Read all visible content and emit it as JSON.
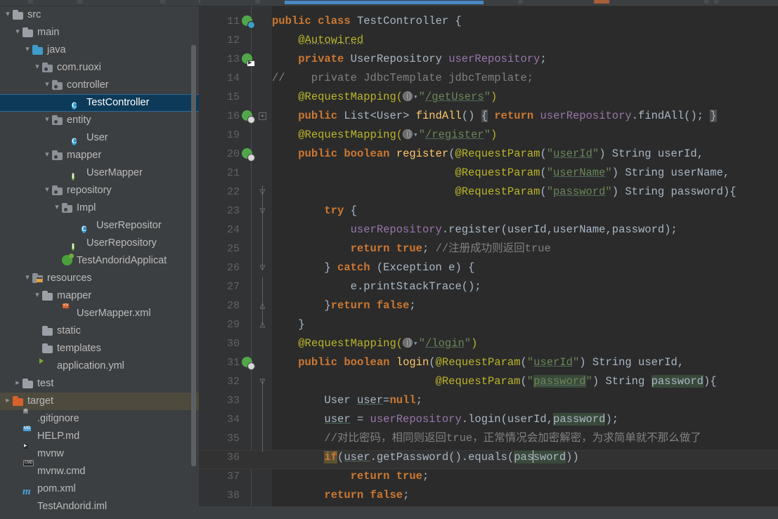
{
  "window": {
    "theme_bg": "#3c3f41",
    "editor_bg": "#2b2b2b",
    "accent": "#4a88c7"
  },
  "project_tree": {
    "items": [
      {
        "label": "src",
        "indent": 0,
        "twisty": "v",
        "icon": "folder-grey",
        "state": "normal"
      },
      {
        "label": "main",
        "indent": 1,
        "twisty": "v",
        "icon": "folder-grey",
        "state": "normal"
      },
      {
        "label": "java",
        "indent": 2,
        "twisty": "v",
        "icon": "folder-blue",
        "state": "normal"
      },
      {
        "label": "com.ruoxi",
        "indent": 3,
        "twisty": "v",
        "icon": "package",
        "state": "normal"
      },
      {
        "label": "controller",
        "indent": 4,
        "twisty": "v",
        "icon": "package",
        "state": "normal"
      },
      {
        "label": "TestController",
        "indent": 6,
        "twisty": "none",
        "icon": "class",
        "state": "selected"
      },
      {
        "label": "entity",
        "indent": 4,
        "twisty": "v",
        "icon": "package",
        "state": "normal"
      },
      {
        "label": "User",
        "indent": 6,
        "twisty": "none",
        "icon": "class",
        "state": "normal"
      },
      {
        "label": "mapper",
        "indent": 4,
        "twisty": "v",
        "icon": "package",
        "state": "normal"
      },
      {
        "label": "UserMapper",
        "indent": 6,
        "twisty": "none",
        "icon": "interface",
        "state": "normal"
      },
      {
        "label": "repository",
        "indent": 4,
        "twisty": "v",
        "icon": "package",
        "state": "normal"
      },
      {
        "label": "Impl",
        "indent": 5,
        "twisty": "v",
        "icon": "package",
        "state": "normal"
      },
      {
        "label": "UserRepositor",
        "indent": 7,
        "twisty": "none",
        "icon": "class",
        "state": "clipped"
      },
      {
        "label": "UserRepository",
        "indent": 6,
        "twisty": "none",
        "icon": "interface",
        "state": "normal"
      },
      {
        "label": "TestAndoridApplicat",
        "indent": 5,
        "twisty": "none",
        "icon": "spring-run",
        "state": "clipped"
      },
      {
        "label": "resources",
        "indent": 2,
        "twisty": "v",
        "icon": "folder-res",
        "state": "normal"
      },
      {
        "label": "mapper",
        "indent": 3,
        "twisty": "v",
        "icon": "folder-grey",
        "state": "normal"
      },
      {
        "label": "UserMapper.xml",
        "indent": 5,
        "twisty": "none",
        "icon": "file-xml",
        "state": "normal"
      },
      {
        "label": "static",
        "indent": 3,
        "twisty": "none",
        "icon": "folder-grey",
        "state": "normal"
      },
      {
        "label": "templates",
        "indent": 3,
        "twisty": "none",
        "icon": "folder-grey",
        "state": "normal"
      },
      {
        "label": "application.yml",
        "indent": 3,
        "twisty": "none",
        "icon": "spring-leaf",
        "state": "normal"
      },
      {
        "label": "test",
        "indent": 1,
        "twisty": ">",
        "icon": "folder-grey",
        "state": "normal"
      },
      {
        "label": "target",
        "indent": 0,
        "twisty": ">",
        "icon": "folder-orange",
        "state": "hovered"
      },
      {
        "label": ".gitignore",
        "indent": 1,
        "twisty": "none",
        "icon": "file-ignore",
        "state": "normal"
      },
      {
        "label": "HELP.md",
        "indent": 1,
        "twisty": "none",
        "icon": "file-md",
        "state": "normal"
      },
      {
        "label": "mvnw",
        "indent": 1,
        "twisty": "none",
        "icon": "file-sh",
        "state": "normal"
      },
      {
        "label": "mvnw.cmd",
        "indent": 1,
        "twisty": "none",
        "icon": "file-cmd",
        "state": "normal"
      },
      {
        "label": "pom.xml",
        "indent": 1,
        "twisty": "none",
        "icon": "file-maven",
        "state": "normal"
      },
      {
        "label": "TestAndorid.iml",
        "indent": 1,
        "twisty": "none",
        "icon": "file-iml",
        "state": "normal"
      }
    ]
  },
  "editor": {
    "file": "TestController",
    "lines": [
      {
        "num": "11",
        "gutter": "spring-bean",
        "fold": "none"
      },
      {
        "num": "12",
        "gutter": "none",
        "fold": "none"
      },
      {
        "num": "13",
        "gutter": "spring-autowire",
        "fold": "none"
      },
      {
        "num": "14",
        "gutter": "none",
        "fold": "none"
      },
      {
        "num": "15",
        "gutter": "none",
        "fold": "none"
      },
      {
        "num": "16",
        "gutter": "spring-url",
        "fold": "plus"
      },
      {
        "num": "19",
        "gutter": "none",
        "fold": "none"
      },
      {
        "num": "20",
        "gutter": "spring-url",
        "fold": "none"
      },
      {
        "num": "21",
        "gutter": "none",
        "fold": "none"
      },
      {
        "num": "22",
        "gutter": "none",
        "fold": "down"
      },
      {
        "num": "23",
        "gutter": "none",
        "fold": "down"
      },
      {
        "num": "24",
        "gutter": "none",
        "fold": "none"
      },
      {
        "num": "25",
        "gutter": "none",
        "fold": "none"
      },
      {
        "num": "26",
        "gutter": "none",
        "fold": "down"
      },
      {
        "num": "27",
        "gutter": "none",
        "fold": "none"
      },
      {
        "num": "28",
        "gutter": "none",
        "fold": "up"
      },
      {
        "num": "29",
        "gutter": "none",
        "fold": "up"
      },
      {
        "num": "30",
        "gutter": "none",
        "fold": "none"
      },
      {
        "num": "31",
        "gutter": "spring-url",
        "fold": "none"
      },
      {
        "num": "32",
        "gutter": "none",
        "fold": "down"
      },
      {
        "num": "33",
        "gutter": "none",
        "fold": "none"
      },
      {
        "num": "34",
        "gutter": "none",
        "fold": "none"
      },
      {
        "num": "35",
        "gutter": "none",
        "fold": "none"
      },
      {
        "num": "36",
        "gutter": "none",
        "fold": "none",
        "current": true
      },
      {
        "num": "37",
        "gutter": "none",
        "fold": "none"
      },
      {
        "num": "38",
        "gutter": "none",
        "fold": "none"
      }
    ],
    "code_text": [
      "public class TestController {",
      "    @Autowired",
      "    private UserRepository userRepository;",
      "//    private JdbcTemplate jdbcTemplate;",
      "    @RequestMapping(\"/getUsers\")",
      "    public List<User> findAll() { return userRepository.findAll(); }",
      "    @RequestMapping(\"/register\")",
      "    public boolean register(@RequestParam(\"userId\") String userId,",
      "                            @RequestParam(\"userName\") String userName,",
      "                            @RequestParam(\"password\") String password){",
      "        try {",
      "            userRepository.register(userId,userName,password);",
      "            return true; //注册成功则返回true",
      "        } catch (Exception e) {",
      "            e.printStackTrace();",
      "        }return false;",
      "    }",
      "    @RequestMapping(\"/login\")",
      "    public boolean login(@RequestParam(\"userId\") String userId,",
      "                         @RequestParam(\"password\") String password){",
      "        User user=null;",
      "        user = userRepository.login(userId,password);",
      "        //对比密码，相同则返回true，正常情况会加密解密，为求简单就不那么做了",
      "        if(user.getPassword().equals(password))",
      "            return true;",
      "        return false;"
    ],
    "comments": {
      "register_success": "//注册成功则返回true",
      "compare_password": "//对比密码，相同则返回true，正常情况会加密解密，为求简单就不那么做了"
    },
    "caret": {
      "line": "36",
      "inside_token": "password",
      "offset": 3
    },
    "highlighted_identifier": "password"
  }
}
